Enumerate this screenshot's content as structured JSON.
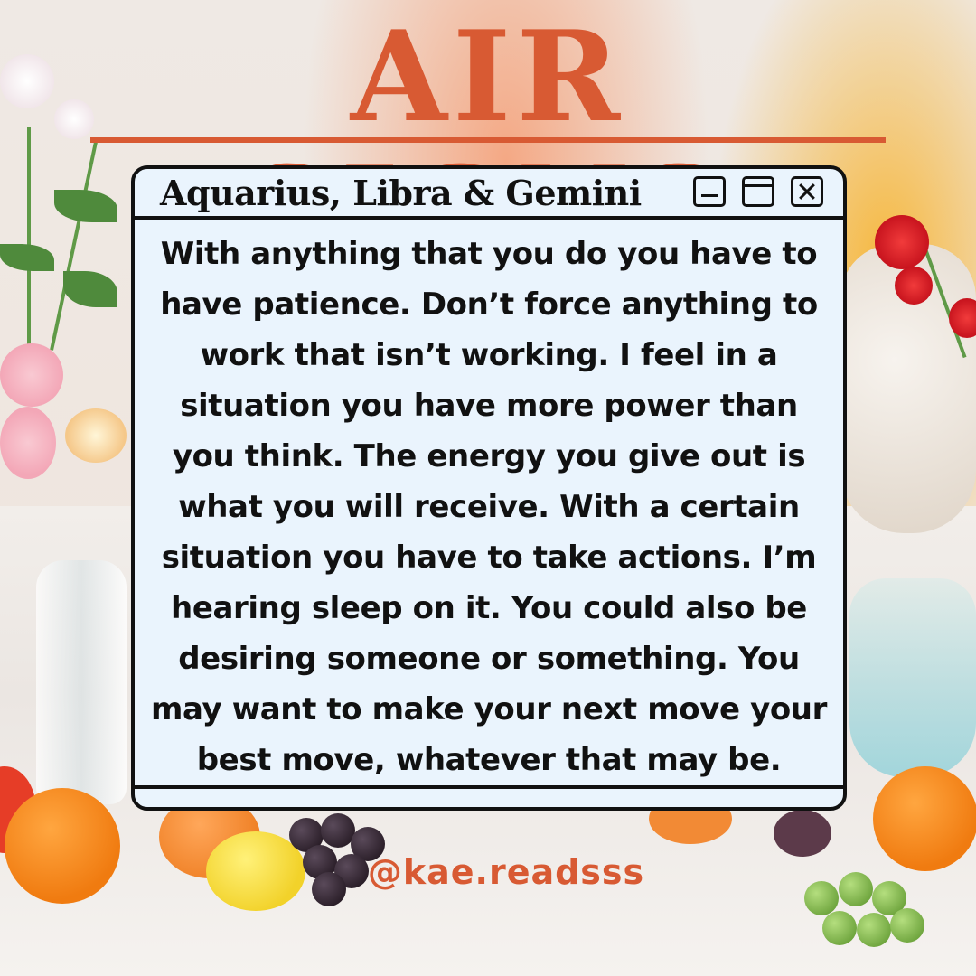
{
  "title": "AIR SIGNS",
  "window": {
    "title": "Aquarius, Libra & Gemini",
    "controls": {
      "minimize_icon": "minimize-icon",
      "maximize_icon": "maximize-icon",
      "close_icon": "close-icon"
    },
    "body": "With anything that you do you have to\nhave patience. Don’t force anything to\nwork that isn’t working. I feel in a\nsituation you have more power than\nyou think. The energy you give out is\nwhat you will receive. With a certain\nsituation you have to take actions. I’m\nhearing sleep on it. You could also be\ndesiring someone or something. You\nmay want to make your next move your\nbest move, whatever that may be."
  },
  "handle": "@kae.readsss",
  "colors": {
    "accent": "#d85a33",
    "window_bg": "#eaf4fd",
    "outline": "#111111"
  }
}
